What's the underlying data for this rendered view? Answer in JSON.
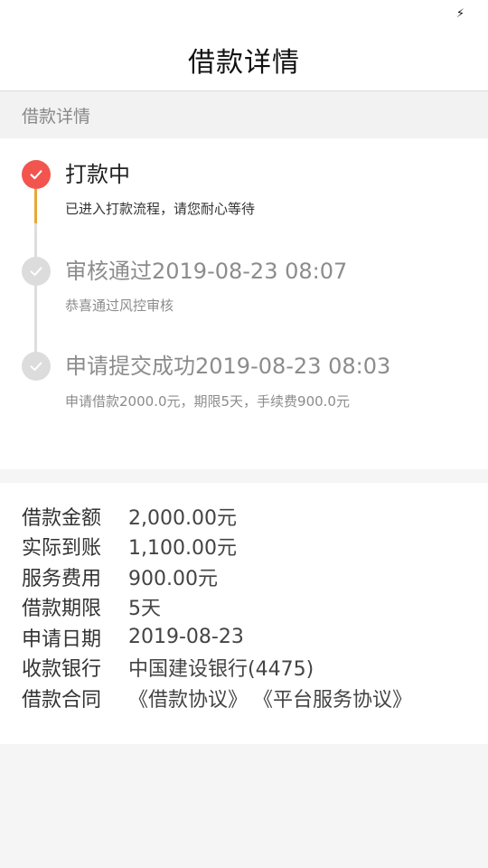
{
  "status_bar": {
    "icon": "lightning-icon"
  },
  "header": {
    "title": "借款详情"
  },
  "section_label": "借款详情",
  "steps": [
    {
      "title": "打款中",
      "desc": "已进入打款流程，请您耐心等待",
      "state": "active"
    },
    {
      "title": "审核通过2019-08-23 08:07",
      "desc": "恭喜通过风控审核",
      "state": "done"
    },
    {
      "title": "申请提交成功2019-08-23 08:03",
      "desc": "申请借款2000.0元，期限5天，手续费900.0元",
      "state": "done"
    }
  ],
  "details": [
    {
      "label": "借款金额",
      "value": "2,000.00元"
    },
    {
      "label": "实际到账",
      "value": "1,100.00元"
    },
    {
      "label": "服务费用",
      "value": "900.00元"
    },
    {
      "label": "借款期限",
      "value": "5天"
    },
    {
      "label": "申请日期",
      "value": "2019-08-23"
    },
    {
      "label": "收款银行",
      "value": "中国建设银行(4475)"
    }
  ],
  "contract": {
    "label": "借款合同",
    "links": [
      "《借款协议》",
      "《平台服务协议》"
    ]
  },
  "colors": {
    "active": "#f2554d",
    "line_active": "#e6a935",
    "inactive": "#dcdcdc"
  }
}
